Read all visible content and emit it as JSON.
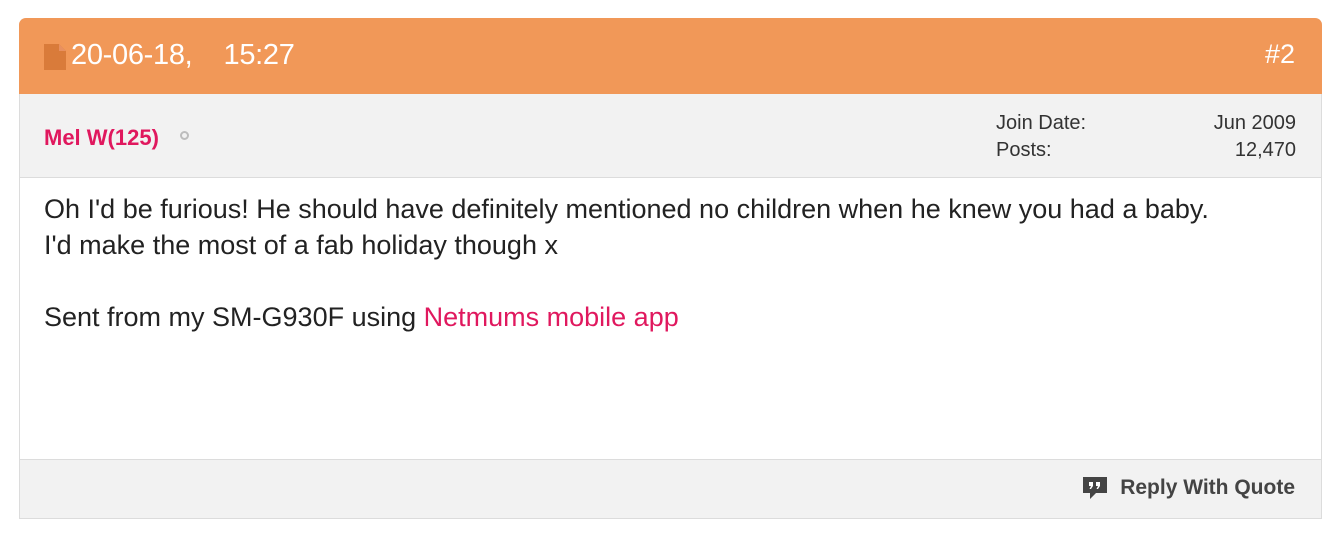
{
  "post": {
    "date": "20-06-18,",
    "time": "15:27",
    "number": "#2",
    "icons": {
      "post_icon": "document-icon",
      "status_icon": "offline-status-icon",
      "quote_icon": "quote-bubble-icon"
    }
  },
  "author": {
    "username": "Mel W(125)",
    "join_date_label": "Join Date:",
    "join_date_value": "Jun 2009",
    "posts_label": "Posts:",
    "posts_value": "12,470"
  },
  "body": {
    "line1": "Oh I'd be furious! He should have definitely mentioned no children when he knew you had a baby.",
    "line2": "I'd make the most of a fab holiday though x",
    "signature_prefix": "Sent from my SM-G930F using ",
    "signature_link": "Netmums mobile app"
  },
  "footer": {
    "reply_label": "Reply With Quote"
  },
  "colors": {
    "header": "#f19858",
    "accent": "#e0185e",
    "bar": "#f2f2f2"
  }
}
